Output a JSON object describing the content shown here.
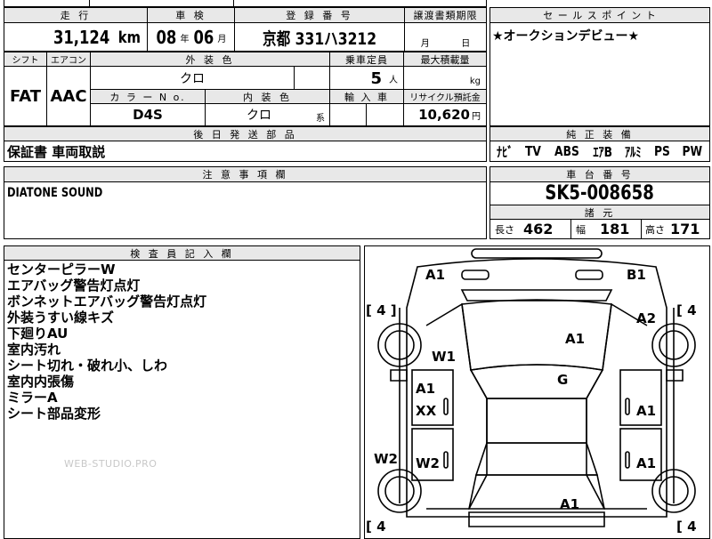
{
  "top": {
    "labels": {
      "mileage": "走 行",
      "inspection": "車 検",
      "registration": "登 録 番 号",
      "transfer_date": "譲渡書類期限",
      "sales_point": "セ ー ル ス ポ イ ン ト"
    },
    "mileage_value": "31,124",
    "mileage_unit": "km",
    "inspection_year": "08",
    "inspection_year_unit": "年",
    "inspection_month": "06",
    "inspection_month_unit": "月",
    "registration_value": "京都 331ハ3212",
    "transfer_month_unit": "月",
    "transfer_day_unit": "日",
    "sales_point_text": "★オークションデビュー★"
  },
  "specs": {
    "labels": {
      "shift": "シフト",
      "aircon": "エアコン",
      "exterior_color": "外 装 色",
      "capacity": "乗車定員",
      "max_load": "最大積載量",
      "color_no": "カ ラ ー N o.",
      "interior_color": "内 装 色",
      "import": "輸 入 車",
      "recycle": "リサイクル預託金"
    },
    "shift_value": "FAT",
    "aircon_value": "AAC",
    "exterior_color_value": "クロ",
    "capacity_value": "5",
    "capacity_unit": "人",
    "max_load_unit": "kg",
    "color_no_value": "D4S",
    "interior_color_value": "クロ",
    "interior_color_suffix": "系",
    "recycle_value": "10,620",
    "recycle_unit": "円"
  },
  "later_parts": {
    "label": "後 日 発 送 部 品",
    "value": "保証書 車両取説"
  },
  "equipment": {
    "label": "純 正 装 備",
    "items": [
      "ﾅﾋﾞ",
      "TV",
      "ABS",
      "ｴｱB",
      "ｱﾙﾐ",
      "PS",
      "PW"
    ]
  },
  "notes": {
    "label": "注 意 事 項 欄",
    "value": "DIATONE SOUND"
  },
  "chassis": {
    "label": "車 台 番 号",
    "value": "SK5-008658"
  },
  "dimensions": {
    "label": "諸 元",
    "length_label": "長さ",
    "length_value": "462",
    "width_label": "幅",
    "width_value": "181",
    "height_label": "高さ",
    "height_value": "171"
  },
  "inspector": {
    "label": "検 査 員 記 入 欄",
    "lines": [
      "センターピラーW",
      "エアバッグ警告灯点灯",
      "ボンネットエアバッグ警告灯点灯",
      "外装うすい線キズ",
      "下廻りAU",
      "室内汚れ",
      "シート切れ・破れ小、しわ",
      "室内内張傷",
      "ミラーA",
      "シート部品変形"
    ]
  },
  "watermark": "WEB-STUDIO.PRO",
  "diagram": {
    "marks": {
      "a1_front_left": "A1",
      "b1_front_right": "B1",
      "a2_right_fender": "A2",
      "a1_hood": "A1",
      "w1_left_fender": "W1",
      "g_windshield": "G",
      "a1_left_front_door": "A1",
      "xx_left_front_door": "XX",
      "a1_right_front_door": "A1",
      "w2_left_pillar": "W2",
      "w2_left_rear_door": "W2",
      "a1_right_rear_door": "A1",
      "a1_rear": "A1"
    },
    "tire_left_front": "[ 4 ]",
    "tire_right_front": "[ 4",
    "tire_left_rear": "[ 4",
    "tire_right_rear": "[ 4"
  }
}
